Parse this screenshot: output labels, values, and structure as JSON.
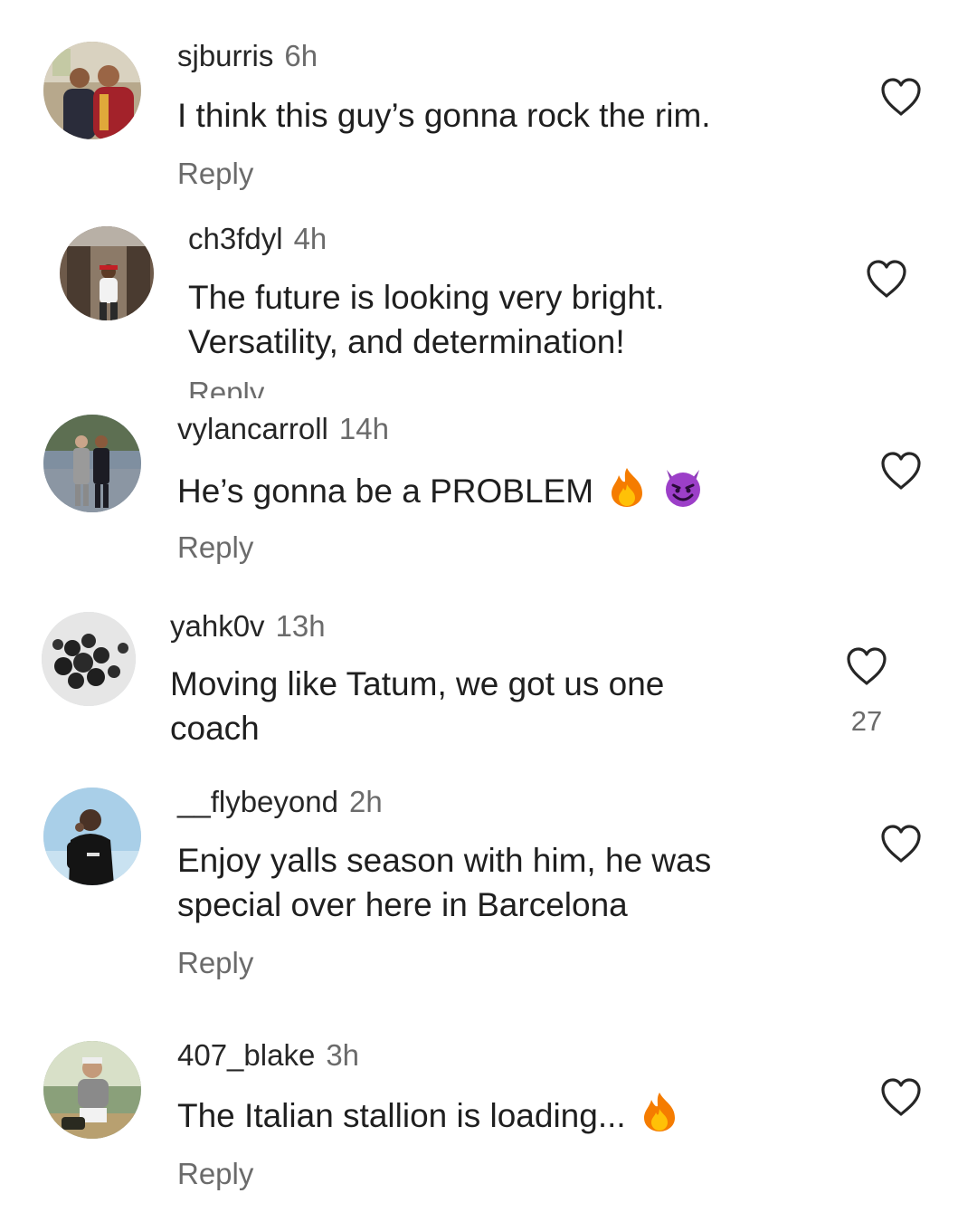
{
  "comments": [
    {
      "username": "sjburris",
      "time": "6h",
      "text": "I think this guy’s gonna rock the rim.",
      "reply_label": "Reply",
      "likes": ""
    },
    {
      "username": "ch3fdyl",
      "time": "4h",
      "text": "The future is looking very bright. Versatility, and determination!",
      "reply_label": "Reply",
      "likes": ""
    },
    {
      "username": "vylancarroll",
      "time": "14h",
      "text": "He’s gonna be a PROBLEM",
      "emojis": [
        "fire-emoji",
        "smiling-devil-emoji"
      ],
      "reply_label": "Reply",
      "likes": ""
    },
    {
      "username": "yahk0v",
      "time": "13h",
      "text": "Moving like Tatum, we got us one coach",
      "reply_label": "",
      "likes": "27"
    },
    {
      "username": "__flybeyond",
      "time": "2h",
      "text": "Enjoy yalls season with him, he was special over here in Barcelona",
      "reply_label": "Reply",
      "likes": ""
    },
    {
      "username": "407_blake",
      "time": "3h",
      "text": "The Italian stallion is loading...",
      "emojis": [
        "fire-emoji"
      ],
      "reply_label": "Reply",
      "likes": ""
    }
  ],
  "icons": {
    "like": "heart-outline-icon"
  },
  "colors": {
    "text": "#1f1f1f",
    "secondary": "#6b6b6b",
    "background": "#ffffff"
  }
}
